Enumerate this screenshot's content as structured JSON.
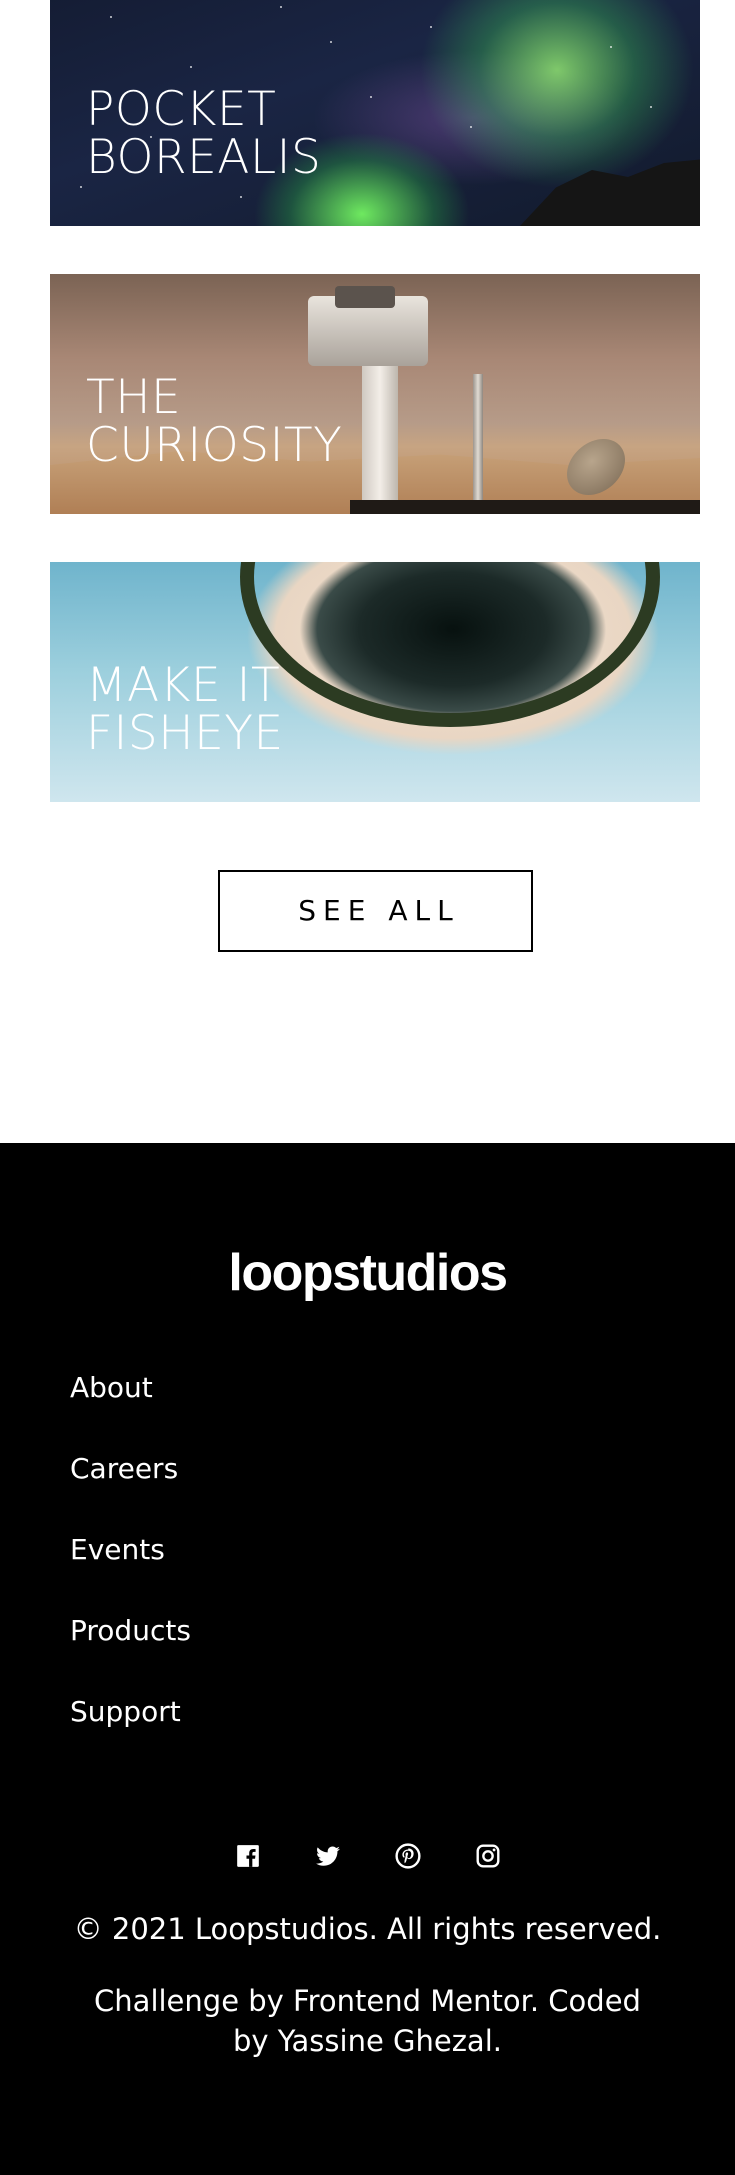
{
  "cards": [
    {
      "title_line1": "POCKET",
      "title_line2": "BOREALIS"
    },
    {
      "title_line1": "THE",
      "title_line2": "CURIOSITY"
    },
    {
      "title_line1": "MAKE IT",
      "title_line2": "FISHEYE"
    }
  ],
  "see_all": {
    "label": "SEE ALL"
  },
  "footer": {
    "logo": "loopstudios",
    "nav": [
      "About",
      "Careers",
      "Events",
      "Products",
      "Support"
    ],
    "socials": [
      "facebook-icon",
      "twitter-icon",
      "pinterest-icon",
      "instagram-icon"
    ],
    "copyright": "© 2021 Loopstudios. All rights reserved.",
    "credit": "Challenge by Frontend Mentor. Coded by Yassine Ghezal."
  },
  "colors": {
    "background": "#ffffff",
    "footer_background": "#000000",
    "text_light": "#ffffff",
    "text_dark": "#000000"
  }
}
